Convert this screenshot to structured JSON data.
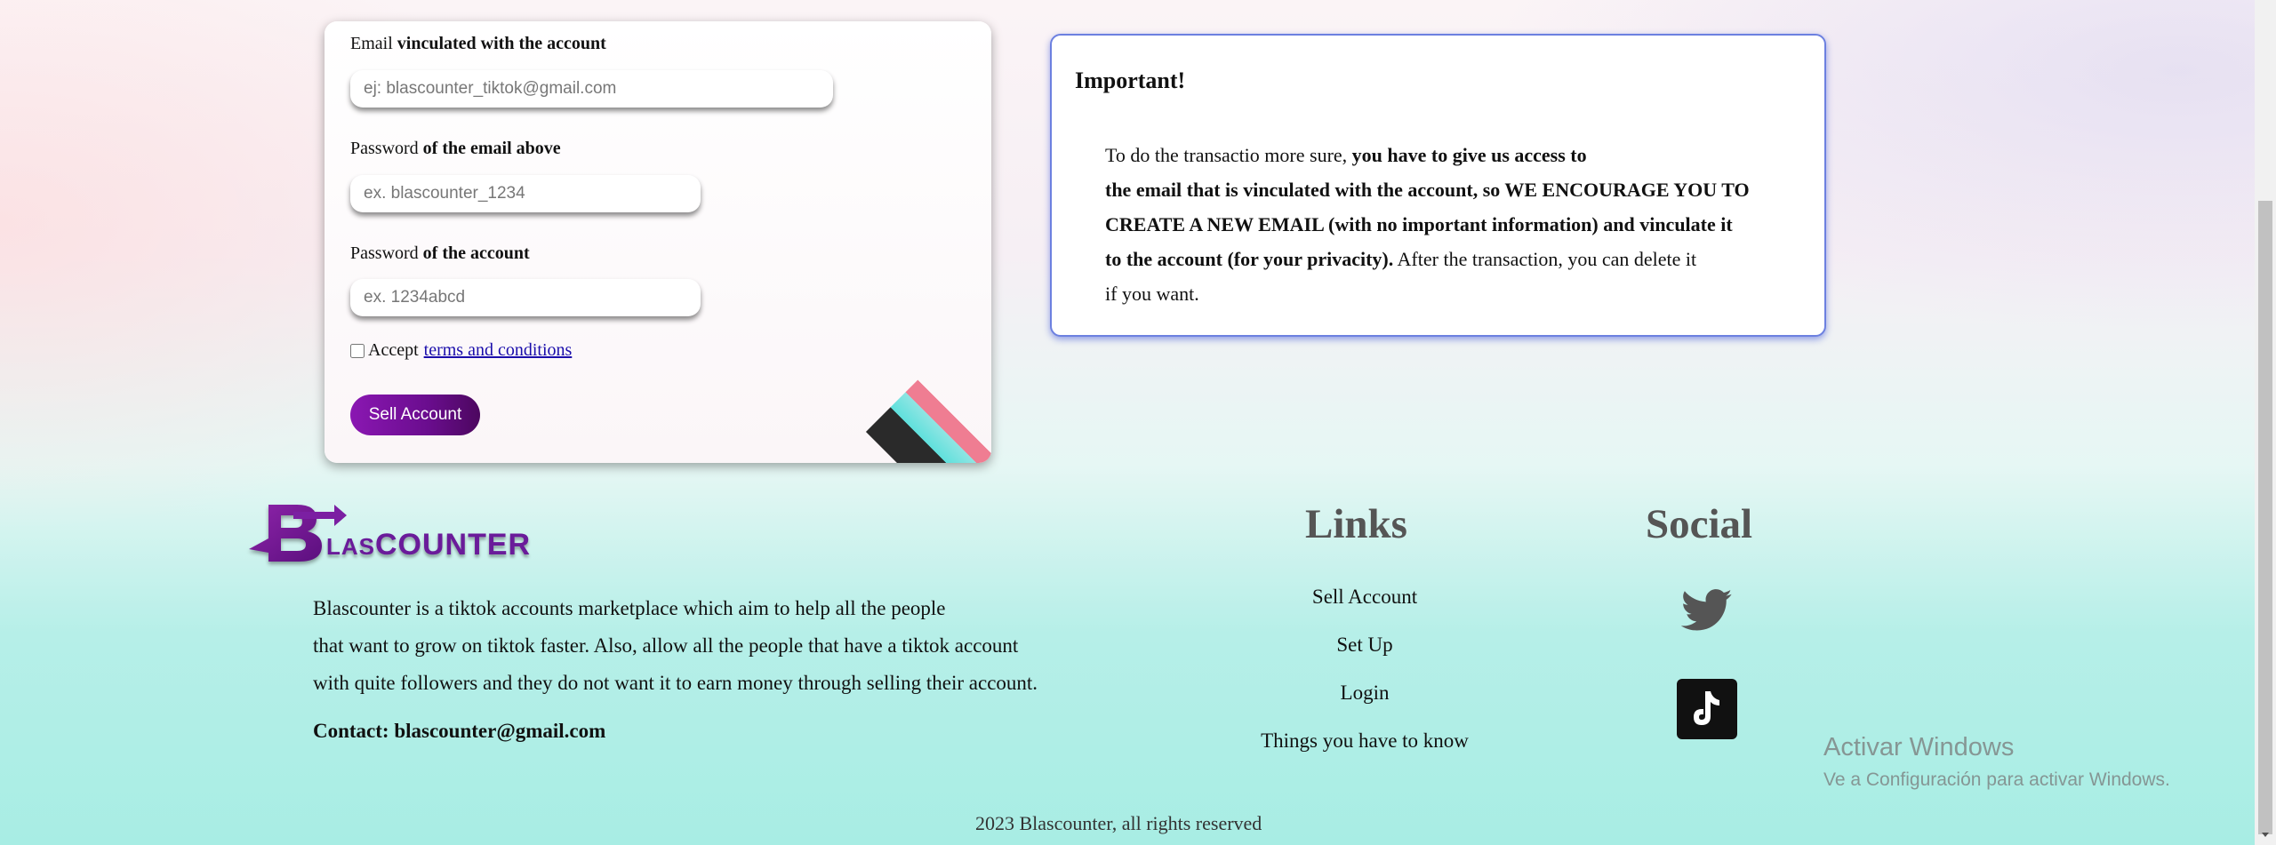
{
  "form": {
    "email_label_plain": "Email",
    "email_label_bold": "vinculated with the account",
    "email_placeholder": "ej: blascounter_tiktok@gmail.com",
    "email_password_label_plain": "Password",
    "email_password_label_bold": "of the email above",
    "email_password_placeholder": "ex. blascounter_1234",
    "account_password_label_plain": "Password",
    "account_password_label_bold": "of the account",
    "account_password_placeholder": "ex. 1234abcd",
    "accept_text": "Accept",
    "terms_link": "terms and conditions",
    "submit_label": "Sell Account"
  },
  "important": {
    "title": "Important!",
    "line1_plain": "To do the transactio more sure,",
    "line1_bold": "you have to give us access to",
    "line2_bold": "the email that is vinculated with the account, so WE ENCOURAGE YOU TO",
    "line3_bold": "CREATE A NEW EMAIL (with no important information) and vinculate it",
    "line4_bold": "to the account (for your privacity).",
    "line4_plain": "After the transaction, you can delete it",
    "line5_plain": "if you want."
  },
  "footer": {
    "brand": {
      "logo_letter": "B",
      "logo_small": "LAS",
      "logo_big": "COUNTER"
    },
    "about_lines": [
      "Blascounter is a tiktok accounts marketplace which aim to help all the people",
      "that want to grow on tiktok faster. Also, allow all the people that have a tiktok account",
      "with quite followers and they do not want it to earn money through selling their account."
    ],
    "contact": "Contact: blascounter@gmail.com",
    "links_heading": "Links",
    "links": [
      "Sell Account",
      "Set Up",
      "Login",
      "Things you have to know"
    ],
    "social_heading": "Social",
    "social_icons": [
      "twitter-icon",
      "tiktok-icon"
    ],
    "copyright": "2023 Blascounter, all rights reserved"
  },
  "watermark": {
    "title": "Activar Windows",
    "subtitle": "Ve a Configuración para activar Windows."
  },
  "colors": {
    "accent_purple": "#7a14a3",
    "important_border": "#6c80e0",
    "link_blue": "#1a0dab"
  }
}
